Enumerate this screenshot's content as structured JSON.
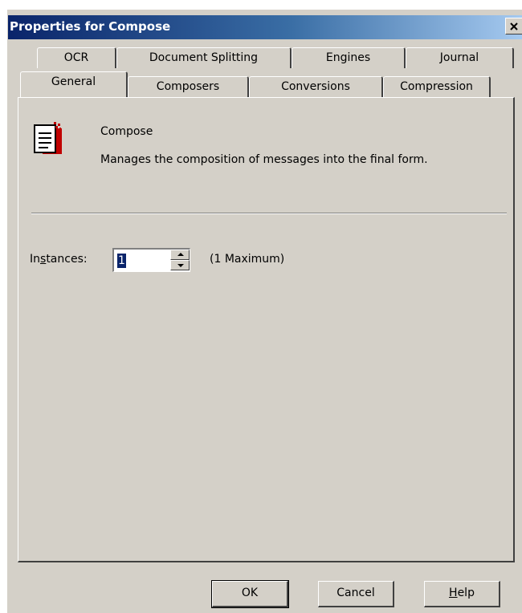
{
  "window": {
    "title": "Properties for Compose",
    "close_glyph": "✕"
  },
  "tabs": {
    "row1": [
      {
        "label": "OCR"
      },
      {
        "label": "Document Splitting"
      },
      {
        "label": "Engines"
      },
      {
        "label": "Journal"
      }
    ],
    "row2": [
      {
        "label": "General",
        "active": true
      },
      {
        "label": "Composers"
      },
      {
        "label": "Conversions"
      },
      {
        "label": "Compression"
      }
    ]
  },
  "general": {
    "icon": "document-compose-icon",
    "name": "Compose",
    "description": "Manages the composition of messages into the final form.",
    "instances_label_pre": "In",
    "instances_label_accel": "s",
    "instances_label_post": "tances:",
    "instances_value": "1",
    "instances_max": "(1 Maximum)"
  },
  "buttons": {
    "ok": "OK",
    "cancel": "Cancel",
    "help_accel": "H",
    "help_rest": "elp"
  },
  "colors": {
    "face": "#d4d0c8",
    "title_start": "#0a246a",
    "title_end": "#a6caf0",
    "selection": "#0a246a"
  }
}
